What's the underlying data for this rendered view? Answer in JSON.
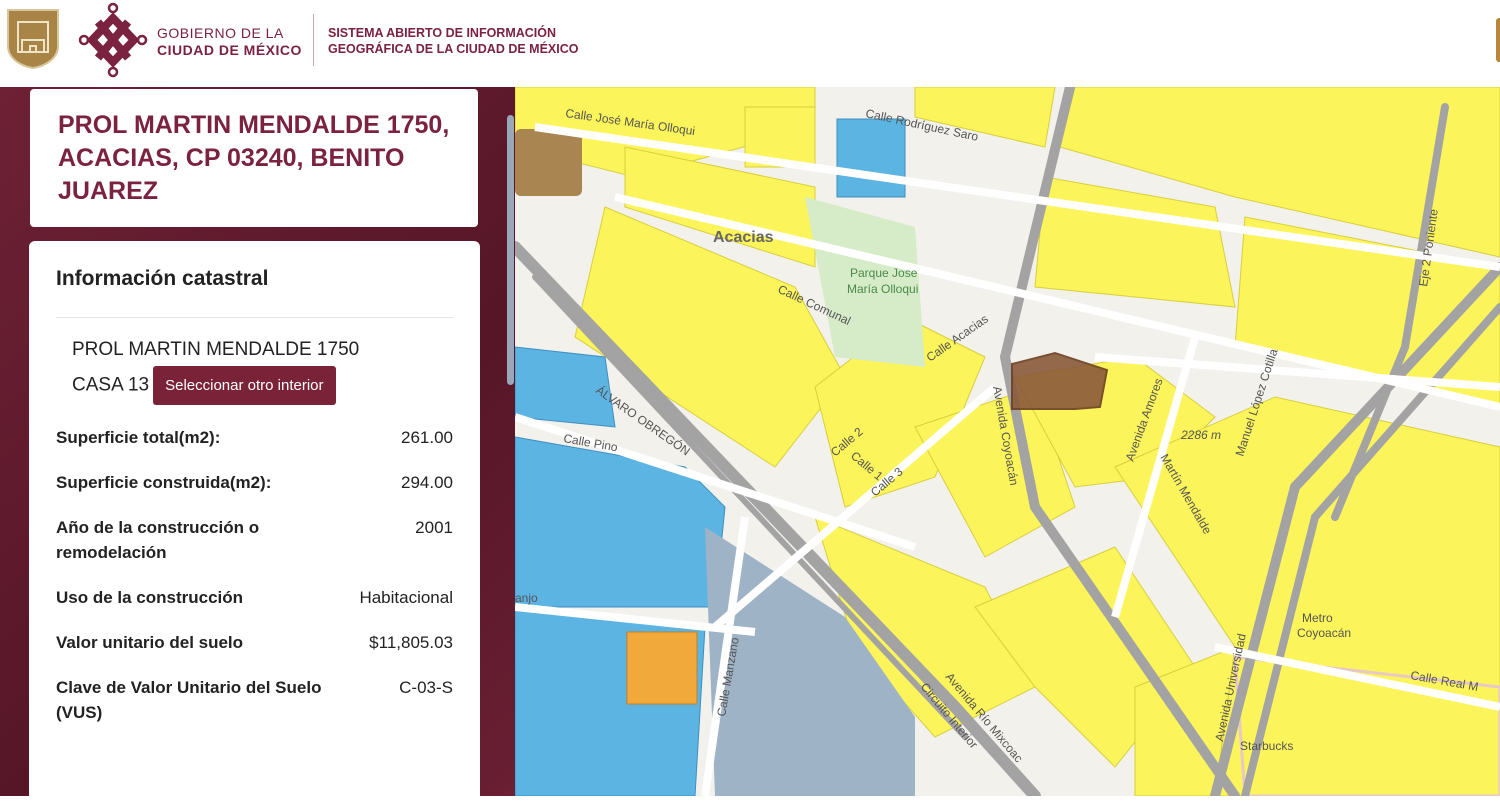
{
  "header": {
    "gov_line1": "GOBIERNO DE LA",
    "gov_line2": "CIUDAD DE MÉXICO",
    "system_line1": "SISTEMA ABIERTO DE INFORMACIÓN",
    "system_line2": "GEOGRÁFICA DE LA CIUDAD DE MÉXICO"
  },
  "address_title": "PROL MARTIN MENDALDE 1750, ACACIAS, CP 03240, BENITO JUAREZ",
  "info": {
    "heading": "Información catastral",
    "unit_line1": "PROL MARTIN MENDALDE 1750",
    "unit_line2": "CASA 13",
    "select_button": "Seleccionar otro interior",
    "rows": [
      {
        "label": "Superficie total(m2):",
        "value": "261.00"
      },
      {
        "label": "Superficie construida(m2):",
        "value": "294.00"
      },
      {
        "label": "Año de la construcción o remodelación",
        "value": "2001"
      },
      {
        "label": "Uso de la construcción",
        "value": "Habitacional"
      },
      {
        "label": "Valor unitario del suelo",
        "value": "$11,805.03"
      },
      {
        "label": "Clave de Valor Unitario del Suelo (VUS)",
        "value": "C-03-S"
      }
    ]
  },
  "map": {
    "labels": {
      "olloqui": "Calle José María Olloqui",
      "saro": "Calle Rodríguez Saro",
      "acacias": "Acacias",
      "parque1": "Parque Jose",
      "parque2": "María Olloqui",
      "comunal": "Calle Comunal",
      "c_acacias": "Calle Acacias",
      "obregon": "ÁLVARO OBREGÓN",
      "pino": "Calle Pino",
      "calle2": "Calle 2",
      "calle1": "Calle 1",
      "calle3": "Calle 3",
      "coyoacan": "Avenida Coyoacán",
      "amores": "Avenida Amores",
      "mendalde": "Martín Mendalde",
      "lopez": "Manuel López Cotilla",
      "eje2": "Eje 2 Poniente",
      "elev": "2286 m",
      "manzano": "Calle Manzano",
      "universidad": "Avenida Universidad",
      "metro1": "Metro",
      "metro2": "Coyoacán",
      "real": "Calle Real M",
      "mixcoac": "Avenida Río Mixcoac",
      "circuito": "Circuito Interior",
      "starbucks": "Starbucks",
      "naranjo": "anjo"
    },
    "colors": {
      "residential": "#fbf45a",
      "blue": "#5cb4e3",
      "selected": "#8a5a3a",
      "road": "#9a9a9a",
      "park": "#d6ebc7"
    }
  }
}
